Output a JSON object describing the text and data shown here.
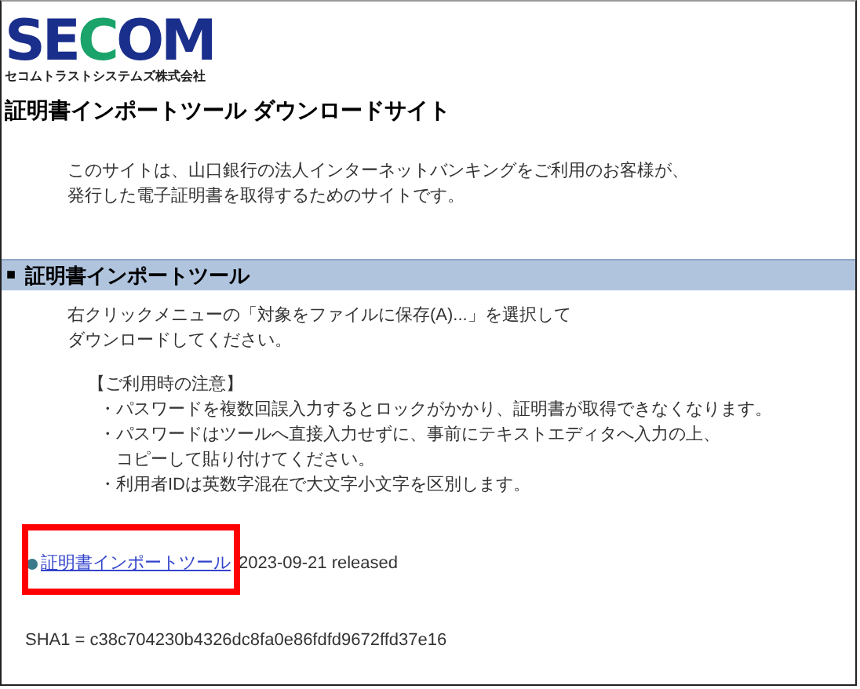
{
  "logo": {
    "parts": [
      {
        "text": "SE",
        "accent": false
      },
      {
        "text": "C",
        "accent": true
      },
      {
        "text": "OM",
        "accent": false
      }
    ],
    "company": "セコムトラストシステムズ株式会社"
  },
  "page_title": "証明書インポートツール ダウンロードサイト",
  "intro": [
    "このサイトは、山口銀行の法人インターネットバンキングをご利用のお客様が、",
    "発行した電子証明書を取得するためのサイトです。"
  ],
  "section": {
    "title": "証明書インポートツール",
    "marker": "■",
    "instructions": [
      "右クリックメニューの「対象をファイルに保存(A)...」を選択して",
      "ダウンロードしてください。"
    ],
    "notes_heading": "【ご利用時の注意】",
    "notes": [
      {
        "lines": [
          "・パスワードを複数回誤入力するとロックがかかり、証明書が取得できなくなります。"
        ]
      },
      {
        "lines": [
          "・パスワードはツールへ直接入力せずに、事前にテキストエディタへ入力の上、",
          "コピーして貼り付けてください。"
        ]
      },
      {
        "lines": [
          "・利用者IDは英数字混在で大文字小文字を区別します。"
        ]
      }
    ],
    "download": {
      "link": "証明書インポートツール",
      "release": "2023-09-21 released",
      "highlighted": true
    },
    "hash": "SHA1 = c38c704230b4326dc8fa0e86fdfd9672ffd37e16"
  }
}
